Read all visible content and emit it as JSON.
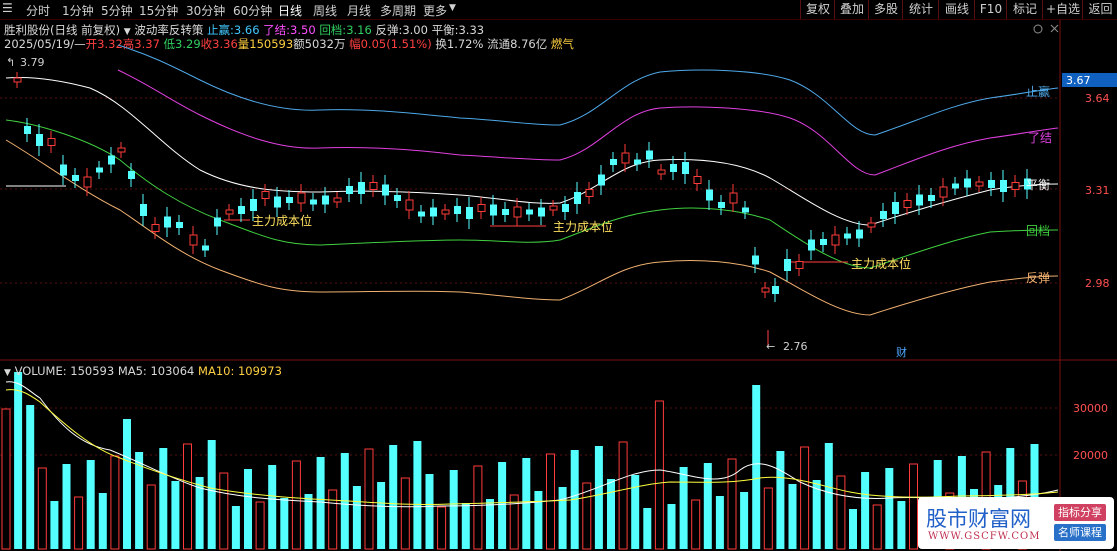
{
  "toolbar": {
    "timeframes": [
      "分时",
      "1分钟",
      "5分钟",
      "15分钟",
      "30分钟",
      "60分钟",
      "日线",
      "周线",
      "月线",
      "多周期",
      "更多"
    ],
    "active_timeframe": "日线",
    "buttons": [
      "复权",
      "叠加",
      "多股",
      "统计",
      "画线",
      "F10",
      "标记",
      "+自选",
      "返回"
    ]
  },
  "stock": {
    "name": "胜利股份(日线 前复权)",
    "indicator": "波动率反转策",
    "zhiying_label": "止赢:",
    "zhiying_value": "3.66",
    "liaojie_label": "了结:",
    "liaojie_value": "3.50",
    "huidang_label": "回档:",
    "huidang_value": "3.16",
    "fantan_label": "反弹:",
    "fantan_value": "3.00",
    "pingheng_label": "平衡:",
    "pingheng_value": "3.33",
    "date": "2025/05/19/—",
    "open_label": "开",
    "open": "3.32",
    "high_label": "高",
    "high": "3.37",
    "low_label": "低",
    "low": "3.29",
    "close_label": "收",
    "close": "3.36",
    "volume_label": "量",
    "volume": "150593",
    "amount_label": "额",
    "amount": "5032万",
    "change_label": "幅",
    "change": "0.05(1.51%)",
    "turnover_label": "换",
    "turnover": "1.72%",
    "float_label": "流通",
    "float": "8.76亿",
    "concept": "燃气"
  },
  "price_axis": {
    "current": "3.67",
    "ticks": [
      "3.64",
      "3.31",
      "2.98"
    ]
  },
  "band_labels": {
    "zhiying": "止赢",
    "liaojie": "了结",
    "pingheng": "平衡",
    "huidang": "回档",
    "fantan": "反弹"
  },
  "annotations": {
    "high_mark": "3.79",
    "low_mark": "2.76",
    "cost_label": "主力成本位",
    "finance_mark": "财"
  },
  "volume": {
    "label": "VOLUME:",
    "value": "150593",
    "ma5_label": "MA5:",
    "ma5": "103064",
    "ma10_label": "MA10:",
    "ma10": "109973",
    "ticks": [
      "30000",
      "20000"
    ]
  },
  "watermark": {
    "main": "股市财富网",
    "tag1": "指标分享",
    "tag2": "名师课程",
    "url": "WWW.GSCFW.COM"
  },
  "colors": {
    "up": "#ff3b3b",
    "down": "#54ffff",
    "zhiying": "#4ea8e8",
    "liaojie": "#e040e0",
    "pingheng": "#ffffff",
    "huidang": "#40d040",
    "fantan": "#f0b070",
    "ma5": "#ffffff",
    "ma10": "#ffff40"
  }
}
